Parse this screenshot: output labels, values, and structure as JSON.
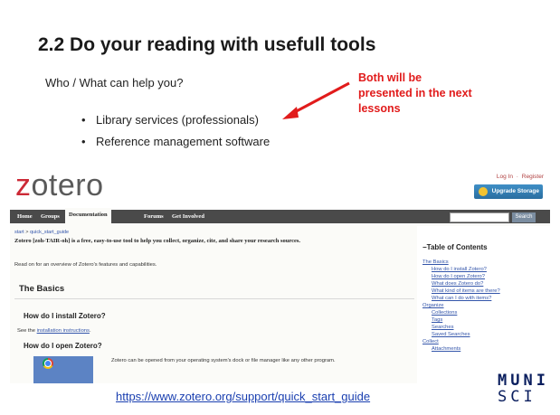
{
  "slide": {
    "title": "2.2 Do your reading with usefull tools",
    "question": "Who / What can help you?",
    "bullets": [
      "Library services (professionals)",
      "Reference management software"
    ],
    "note": "Both will be presented in the next lessons",
    "url": "https://www.zotero.org/support/quick_start_guide",
    "logo_line1": "MUNI",
    "logo_line2": "SCI",
    "accent_color": "#e11b1b"
  },
  "zotero": {
    "logo_z": "z",
    "logo_rest": "otero",
    "auth": {
      "login": "Log In",
      "sep": "·",
      "register": "Register"
    },
    "upgrade_label": "Upgrade Storage",
    "nav": [
      "Home",
      "Groups",
      "Documentation",
      "Forums",
      "Get Involved"
    ],
    "search_label": "Search",
    "breadcrumb": {
      "start": "start",
      "sep": ">",
      "page": "quick_start_guide"
    },
    "intro": "Zotero [zoh-TAIR-oh] is a free, easy-to-use tool to help you collect, organize, cite, and share your research sources.",
    "intro2": "Read on for an overview of Zotero's features and capabilities.",
    "basics_heading": "The Basics",
    "install_heading": "How do I install Zotero?",
    "see_prefix": "See the ",
    "see_link": "installation instructions",
    "see_suffix": ".",
    "open_heading": "How do I open Zotero?",
    "open_text": "Zotero can be opened from your operating system's dock or file manager like any other program.",
    "toc": {
      "title": "−Table of Contents",
      "items": [
        "The Basics",
        "How do I install Zotero?",
        "How do I open Zotero?",
        "What does Zotero do?",
        "What kind of items are there?",
        "What can I do with items?",
        "Organize",
        "Collections",
        "Tags",
        "Searches",
        "Saved Searches",
        "Collect",
        "Attachments"
      ]
    }
  }
}
